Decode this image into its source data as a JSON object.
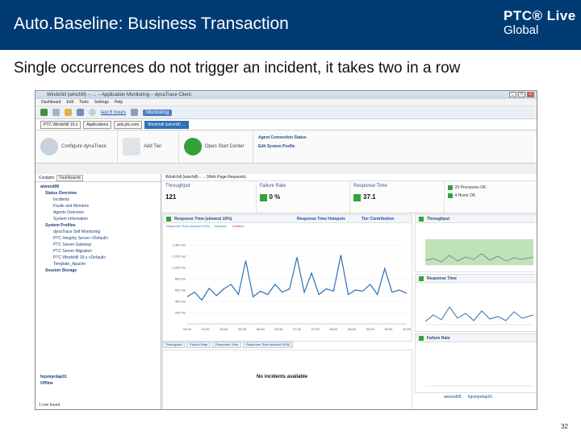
{
  "slide": {
    "title": "Auto.Baseline: Business Transaction",
    "subtitle": "Single occurrences do not trigger an incident, it takes two in a row",
    "logo_line1": "PTC® Live",
    "logo_line2": "Global",
    "page_number": "32",
    "colors": {
      "header": "#003b73",
      "accent": "#34a13b"
    }
  },
  "window": {
    "title": "Windchill (winchill) – … – Application Monitoring – dynaTrace Client",
    "menu": [
      "Dashboard",
      "Edit",
      "Tools",
      "Settings",
      "Help"
    ],
    "toolbar": {
      "time_link": "last 6 hours",
      "mode_chip": "Monitoring"
    },
    "address": [
      "PTC Windchill 10.x",
      "Applications",
      "pds.ptc.com",
      "Windchill (winchill) …"
    ],
    "ribbon": {
      "configure": "Configure dynaTrace",
      "add_tier": "Add Tier",
      "open_start": "Open Start Center",
      "link_agent": "Agent Connection Status",
      "link_profile": "Edit System Profile"
    }
  },
  "left_pane": {
    "filter_labels": [
      "Cockpits",
      "Dashboards"
    ],
    "tree": [
      {
        "label": "atwood08",
        "bold": true
      },
      {
        "label": "Status Overview",
        "bold": true
      },
      {
        "label": "Incidents",
        "bold": false
      },
      {
        "label": "Faults and Monitors",
        "bold": false
      },
      {
        "label": "Agents Overview",
        "bold": false
      },
      {
        "label": "System Information",
        "bold": false
      },
      {
        "label": "System Profiles",
        "bold": true
      },
      {
        "label": "dynaTrace Self Monitoring",
        "bold": false
      },
      {
        "label": "PTC Integrity Server <Default>",
        "bold": false
      },
      {
        "label": "PTC Server Gateway",
        "bold": false
      },
      {
        "label": "PTC Server Migration",
        "bold": false
      },
      {
        "label": "PTC Windchill 10.x <Default>",
        "bold": false
      },
      {
        "label": "Template_Apache",
        "bold": false
      },
      {
        "label": "Session Storage",
        "bold": true
      }
    ],
    "bottom_items": [
      "hqsmprdap01",
      "Offline"
    ],
    "status": "1 row found"
  },
  "right_pane": {
    "header": "Windchill (winchill) - ... (Web Page Requests)",
    "kpis": [
      {
        "label": "Throughput",
        "value": "121",
        "has_square": false
      },
      {
        "label": "Failure Rate",
        "value": "0 %",
        "has_square": true
      },
      {
        "label": "Response Time",
        "value": "37.1",
        "has_square": true
      }
    ],
    "ok_status": [
      "29 Processes OK",
      "4 Hosts OK"
    ],
    "main_chart_title": "Response Time (slowest 10%)",
    "main_chart_links": [
      "Response Time Hotspots",
      "Tier Contribution"
    ],
    "legend": [
      "Response Time (slowest 10%)",
      "Baseline",
      "Violation"
    ],
    "tabs": [
      "Throughput",
      "Failure Rate",
      "Response Time",
      "Response Time (slowest 10%)"
    ],
    "no_incidents": "No incidents available",
    "side_titles": [
      "Throughput",
      "Response Time",
      "Failure Rate"
    ],
    "footer_hosts": [
      "atwood08",
      "hqsmprdap01"
    ]
  },
  "chart_data": [
    {
      "type": "line",
      "title": "Response Time (slowest 10%)",
      "ylabel": "",
      "xlabel": "",
      "ylim": [
        0,
        1600
      ],
      "yticks": [
        "1,400 ms",
        "1,200 ms",
        "1,000 ms",
        "800 ms",
        "600 ms",
        "400 ms",
        "200 ms"
      ],
      "x": [
        "04:00",
        "04:30",
        "05:00",
        "05:30",
        "06:00",
        "06:30",
        "07:00",
        "07:30",
        "08:00",
        "08:30",
        "09:00",
        "09:30",
        "10:00"
      ],
      "series": [
        {
          "name": "Response Time (slowest 10%)",
          "color": "#2f6fb5",
          "values": [
            480,
            560,
            420,
            630,
            500,
            620,
            700,
            520,
            1120,
            480,
            580,
            520,
            700,
            560,
            620,
            1180,
            560,
            900,
            520,
            620,
            580,
            1220,
            520,
            600,
            580,
            700,
            520,
            980,
            560,
            600,
            540
          ]
        }
      ]
    }
  ]
}
